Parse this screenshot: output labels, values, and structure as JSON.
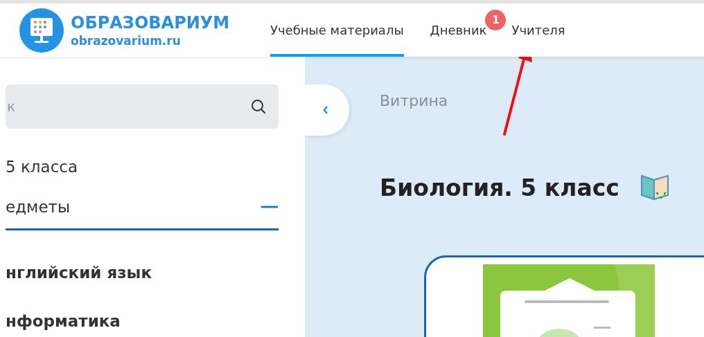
{
  "header": {
    "logo_title": "ОБРАЗОВАРИУМ",
    "logo_domain": "obrazovarium.ru"
  },
  "nav": [
    {
      "label": "Учебные материалы",
      "selected": true
    },
    {
      "label": "Дневник",
      "selected": false,
      "badge": "1"
    },
    {
      "label": "Учителя",
      "selected": false
    }
  ],
  "sidebar": {
    "search": {
      "placeholder": "к"
    },
    "grade": "5 класса",
    "section": {
      "label": "едметы",
      "expanded": true
    },
    "items": [
      "нглийский язык",
      "нформатика"
    ]
  },
  "showcase": {
    "breadcrumb": "Витрина",
    "title": "Биология. 5 класс"
  }
}
